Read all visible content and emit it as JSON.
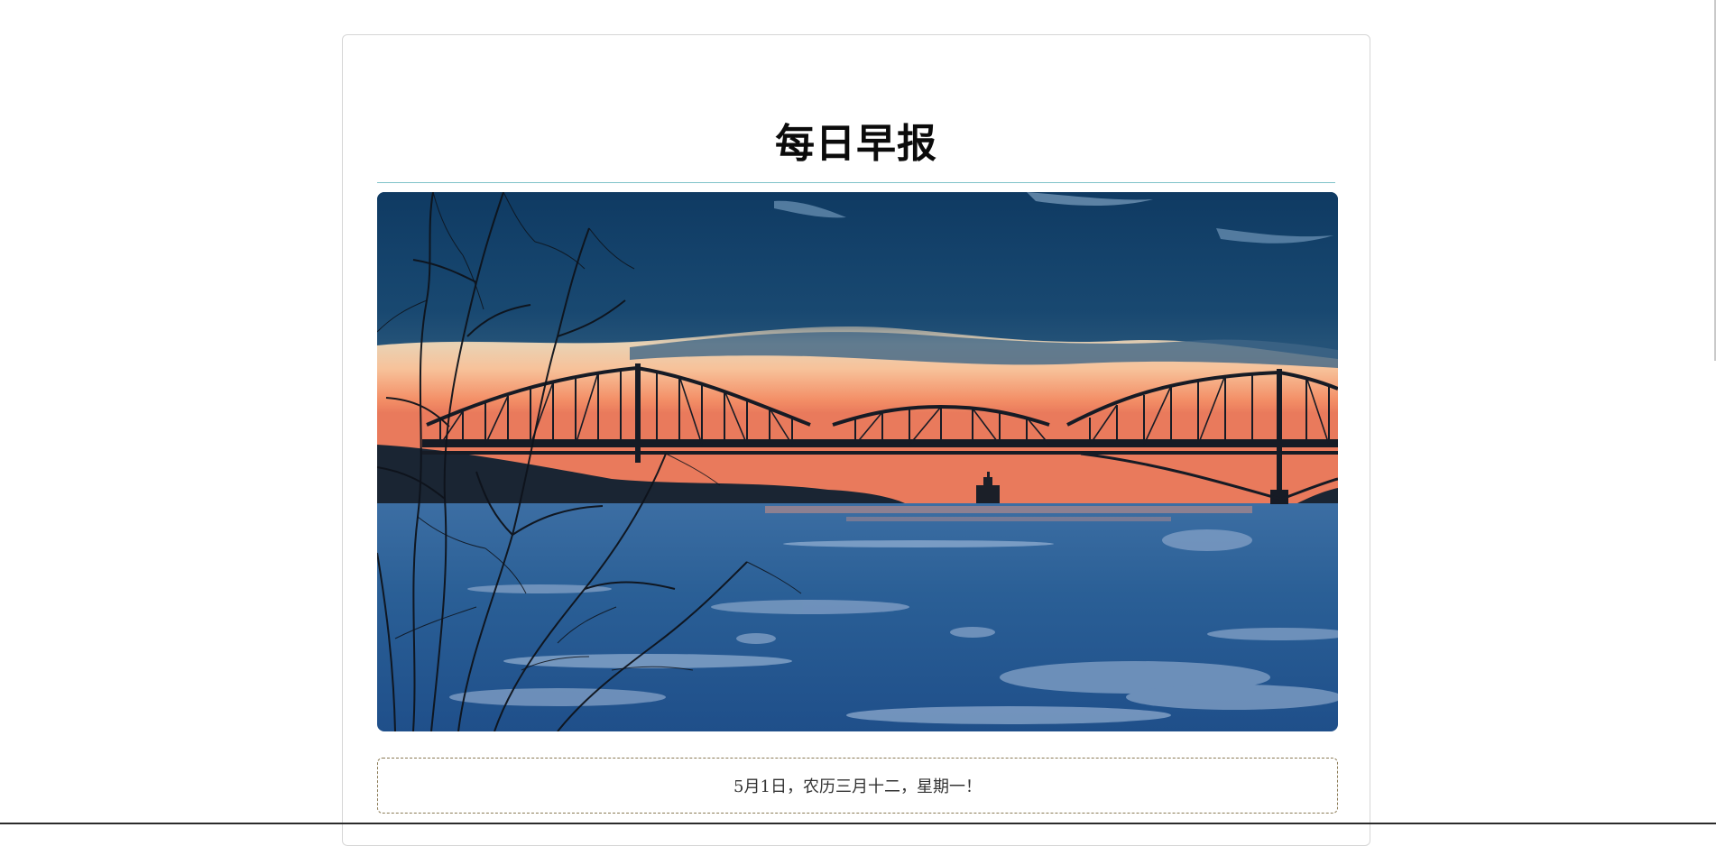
{
  "page": {
    "title": "每日早报",
    "date_line": "5月1日，农历三月十二，星期一！"
  },
  "photo": {
    "subject": "bridge-at-dusk-over-icy-river"
  },
  "colors": {
    "divider": "#7fc3c9",
    "card_border": "#d6d6d6",
    "date_border": "#8a7a55",
    "sky_top": "#0e3a63",
    "sunset": "#f19a6b",
    "water": "#2a5f96"
  }
}
